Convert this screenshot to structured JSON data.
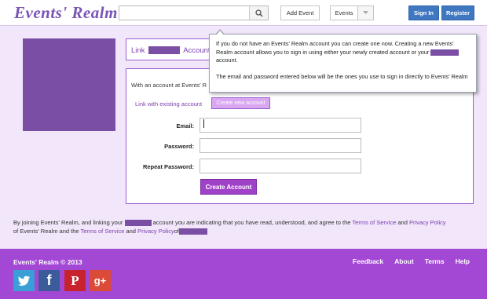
{
  "header": {
    "logo": "Events' Realm",
    "search_placeholder": "",
    "add_event": "Add Event",
    "events": "Events",
    "sign_in": "Sign In",
    "register": "Register"
  },
  "link_header": {
    "prefix": "Link",
    "suffix": "Account"
  },
  "panel": {
    "with_account_text": "With an account at Events' R",
    "tab_link": "Link with existing account",
    "tab_create": "Create new account",
    "email_label": "Email:",
    "password_label": "Password:",
    "repeat_label": "Repeat Password:",
    "submit": "Create Account"
  },
  "tooltip": {
    "para1a": "If you do not have an Events' Realm account you can create one now. Creating a new Events' Realm account allows you to sign in using either your newly created account or your",
    "para1b": "account.",
    "para2": "The email and password entered below will be the ones you use to sign in directly to Events' Realm"
  },
  "disclaimer": {
    "part1": "By joining Events' Realm, and linking your",
    "part2": "account you are indicating that you have read, understood, and agree to the",
    "terms1": "Terms of Service",
    "and1": "and",
    "privacy1": "Privacy Policy",
    "part3": "of Events' Realm and the",
    "terms2": "Terms of Service",
    "and2": "and",
    "privacy2": "Privacy Policy",
    "of": "of"
  },
  "footer": {
    "copyright": "Events' Realm © 2013",
    "links": [
      "Feedback",
      "About",
      "Terms",
      "Help"
    ],
    "social": [
      {
        "icon": "twitter-icon",
        "glyph": "🐦",
        "color": "#3a9fd6"
      },
      {
        "icon": "facebook-icon",
        "glyph": "f",
        "color": "#3b5b9a"
      },
      {
        "icon": "pinterest-icon",
        "glyph": "P",
        "color": "#c8232c"
      },
      {
        "icon": "google-plus-icon",
        "glyph": "g+",
        "color": "#dc4a38"
      }
    ]
  },
  "colors": {
    "accent": "#a248d4",
    "link": "#7a3fb0",
    "button_blue": "#3f77c1",
    "redaction": "#7a4ea5"
  }
}
